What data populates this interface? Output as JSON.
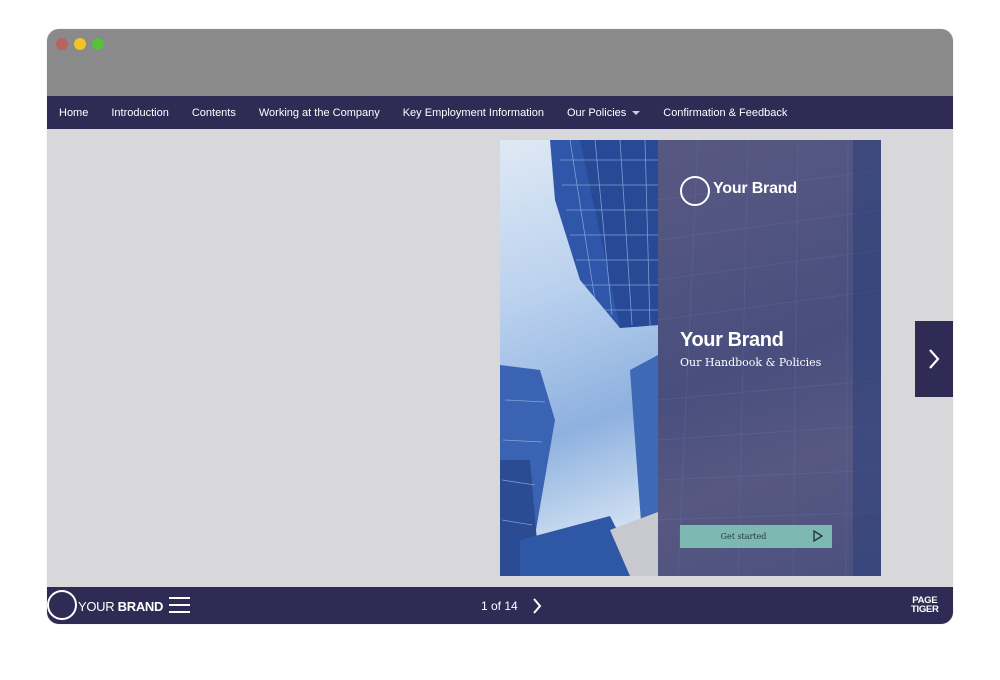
{
  "nav": {
    "items": [
      {
        "label": "Home"
      },
      {
        "label": "Introduction"
      },
      {
        "label": "Contents"
      },
      {
        "label": "Working at the Company"
      },
      {
        "label": "Key Employment Information"
      },
      {
        "label": "Our Policies"
      },
      {
        "label": "Confirmation & Feedback"
      }
    ]
  },
  "cover": {
    "logo_text": "Your Brand",
    "title": "Your Brand",
    "subtitle": "Our Handbook & Policies",
    "cta_label": "Get started"
  },
  "footer": {
    "brand_light": "YOUR ",
    "brand_bold": "BRAND",
    "page_indicator": "1 of 14",
    "vendor_line1": "PAGE",
    "vendor_line2": "TIGER"
  },
  "colors": {
    "nav_bg": "#2f2b55",
    "content_bg": "#d8d8db",
    "cta_bg": "#7db8b2",
    "titlebar_bg": "#8a8a8a"
  }
}
